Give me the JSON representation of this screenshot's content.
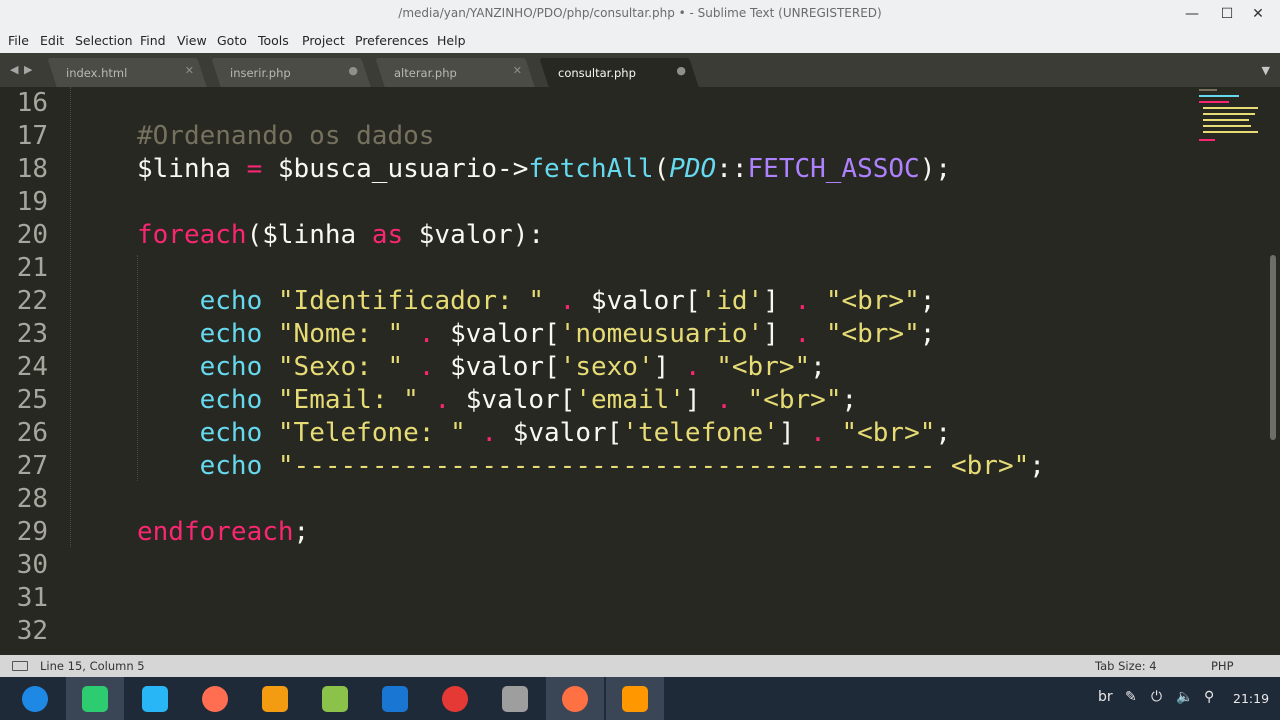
{
  "window": {
    "title": "/media/yan/YANZINHO/PDO/php/consultar.php • - Sublime Text (UNREGISTERED)",
    "minimize_glyph": "—",
    "maximize_glyph": "☐",
    "close_glyph": "✕"
  },
  "menu": [
    "File",
    "Edit",
    "Selection",
    "Find",
    "View",
    "Goto",
    "Tools",
    "Project",
    "Preferences",
    "Help"
  ],
  "tabs": [
    {
      "label": "index.html",
      "control": "✕",
      "active": false
    },
    {
      "label": "inserir.php",
      "control": "●",
      "active": false
    },
    {
      "label": "alterar.php",
      "control": "✕",
      "active": false
    },
    {
      "label": "consultar.php",
      "control": "●",
      "active": true
    }
  ],
  "tabbar": {
    "prev_glyph": "◀",
    "next_glyph": "▶",
    "dropdown_glyph": "▼"
  },
  "editor": {
    "line_numbers": [
      "16",
      "17",
      "18",
      "19",
      "20",
      "21",
      "22",
      "23",
      "24",
      "25",
      "26",
      "27",
      "28",
      "29",
      "30",
      "31",
      "32"
    ],
    "lines": [
      [],
      [
        {
          "t": "#Ordenando os dados",
          "c": "comment"
        }
      ],
      [
        {
          "t": "$linha ",
          "c": "plain"
        },
        {
          "t": "=",
          "c": "keyword"
        },
        {
          "t": " $busca_usuario->",
          "c": "plain"
        },
        {
          "t": "fetchAll",
          "c": "func"
        },
        {
          "t": "(",
          "c": "plain"
        },
        {
          "t": "PDO",
          "c": "class"
        },
        {
          "t": "::",
          "c": "plain"
        },
        {
          "t": "FETCH_ASSOC",
          "c": "const"
        },
        {
          "t": ");",
          "c": "plain"
        }
      ],
      [],
      [
        {
          "t": "foreach",
          "c": "keyword"
        },
        {
          "t": "($linha ",
          "c": "plain"
        },
        {
          "t": "as",
          "c": "keyword"
        },
        {
          "t": " $valor):",
          "c": "plain"
        }
      ],
      [],
      [
        {
          "t": "    ",
          "c": "plain"
        },
        {
          "t": "echo",
          "c": "func"
        },
        {
          "t": " ",
          "c": "plain"
        },
        {
          "t": "\"Identificador: \"",
          "c": "string"
        },
        {
          "t": " ",
          "c": "plain"
        },
        {
          "t": ".",
          "c": "keyword"
        },
        {
          "t": " $valor[",
          "c": "plain"
        },
        {
          "t": "'id'",
          "c": "string"
        },
        {
          "t": "] ",
          "c": "plain"
        },
        {
          "t": ".",
          "c": "keyword"
        },
        {
          "t": " ",
          "c": "plain"
        },
        {
          "t": "\"<br>\"",
          "c": "string"
        },
        {
          "t": ";",
          "c": "plain"
        }
      ],
      [
        {
          "t": "    ",
          "c": "plain"
        },
        {
          "t": "echo",
          "c": "func"
        },
        {
          "t": " ",
          "c": "plain"
        },
        {
          "t": "\"Nome: \"",
          "c": "string"
        },
        {
          "t": " ",
          "c": "plain"
        },
        {
          "t": ".",
          "c": "keyword"
        },
        {
          "t": " $valor[",
          "c": "plain"
        },
        {
          "t": "'nomeusuario'",
          "c": "string"
        },
        {
          "t": "] ",
          "c": "plain"
        },
        {
          "t": ".",
          "c": "keyword"
        },
        {
          "t": " ",
          "c": "plain"
        },
        {
          "t": "\"<br>\"",
          "c": "string"
        },
        {
          "t": ";",
          "c": "plain"
        }
      ],
      [
        {
          "t": "    ",
          "c": "plain"
        },
        {
          "t": "echo",
          "c": "func"
        },
        {
          "t": " ",
          "c": "plain"
        },
        {
          "t": "\"Sexo: \"",
          "c": "string"
        },
        {
          "t": " ",
          "c": "plain"
        },
        {
          "t": ".",
          "c": "keyword"
        },
        {
          "t": " $valor[",
          "c": "plain"
        },
        {
          "t": "'sexo'",
          "c": "string"
        },
        {
          "t": "] ",
          "c": "plain"
        },
        {
          "t": ".",
          "c": "keyword"
        },
        {
          "t": " ",
          "c": "plain"
        },
        {
          "t": "\"<br>\"",
          "c": "string"
        },
        {
          "t": ";",
          "c": "plain"
        }
      ],
      [
        {
          "t": "    ",
          "c": "plain"
        },
        {
          "t": "echo",
          "c": "func"
        },
        {
          "t": " ",
          "c": "plain"
        },
        {
          "t": "\"Email: \"",
          "c": "string"
        },
        {
          "t": " ",
          "c": "plain"
        },
        {
          "t": ".",
          "c": "keyword"
        },
        {
          "t": " $valor[",
          "c": "plain"
        },
        {
          "t": "'email'",
          "c": "string"
        },
        {
          "t": "] ",
          "c": "plain"
        },
        {
          "t": ".",
          "c": "keyword"
        },
        {
          "t": " ",
          "c": "plain"
        },
        {
          "t": "\"<br>\"",
          "c": "string"
        },
        {
          "t": ";",
          "c": "plain"
        }
      ],
      [
        {
          "t": "    ",
          "c": "plain"
        },
        {
          "t": "echo",
          "c": "func"
        },
        {
          "t": " ",
          "c": "plain"
        },
        {
          "t": "\"Telefone: \"",
          "c": "string"
        },
        {
          "t": " ",
          "c": "plain"
        },
        {
          "t": ".",
          "c": "keyword"
        },
        {
          "t": " $valor[",
          "c": "plain"
        },
        {
          "t": "'telefone'",
          "c": "string"
        },
        {
          "t": "] ",
          "c": "plain"
        },
        {
          "t": ".",
          "c": "keyword"
        },
        {
          "t": " ",
          "c": "plain"
        },
        {
          "t": "\"<br>\"",
          "c": "string"
        },
        {
          "t": ";",
          "c": "plain"
        }
      ],
      [
        {
          "t": "    ",
          "c": "plain"
        },
        {
          "t": "echo",
          "c": "func"
        },
        {
          "t": " ",
          "c": "plain"
        },
        {
          "t": "\"----------------------------------------- <br>\"",
          "c": "string"
        },
        {
          "t": ";",
          "c": "plain"
        }
      ],
      [],
      [
        {
          "t": "endforeach",
          "c": "keyword"
        },
        {
          "t": ";",
          "c": "plain"
        }
      ],
      [],
      [],
      []
    ]
  },
  "status": {
    "position": "Line 15, Column 5",
    "tab_size": "Tab Size: 4",
    "syntax": "PHP"
  },
  "taskbar": {
    "apps": [
      {
        "name": "app-launcher-icon",
        "color": "#1e88e5"
      },
      {
        "name": "desktop-icon",
        "color": "#2ecc71"
      },
      {
        "name": "store-icon",
        "color": "#29b6f6"
      },
      {
        "name": "screen-recorder-icon",
        "color": "#ff6e50"
      },
      {
        "name": "archive-manager-icon",
        "color": "#f39c12"
      },
      {
        "name": "music-player-icon",
        "color": "#8bc34a"
      },
      {
        "name": "video-player-icon",
        "color": "#1976d2"
      },
      {
        "name": "chrome-icon",
        "color": "#e53935"
      },
      {
        "name": "settings-icon",
        "color": "#9e9e9e"
      },
      {
        "name": "firefox-icon",
        "color": "#ff7043"
      },
      {
        "name": "sublime-text-icon",
        "color": "#ff9800"
      }
    ],
    "keyboard_layout": "br",
    "clock": "21:19"
  }
}
